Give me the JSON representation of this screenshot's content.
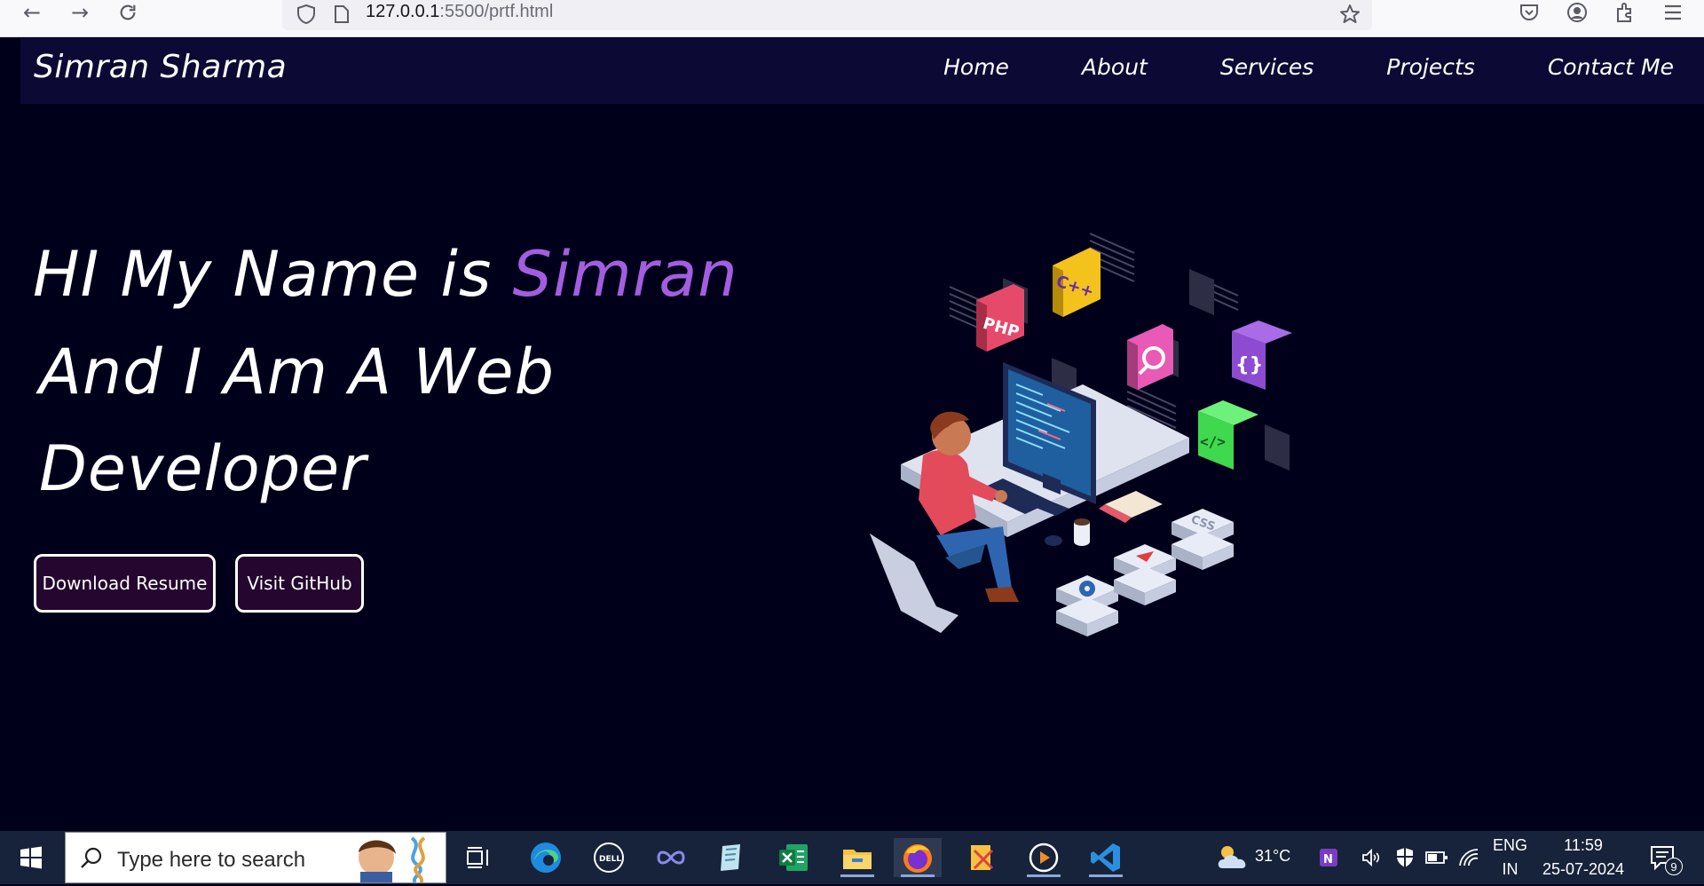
{
  "browser": {
    "url_host": "127.0.0.1",
    "url_path": ":5500/prtf.html"
  },
  "navbar": {
    "brand": "Simran Sharma",
    "links": [
      "Home",
      "About",
      "Services",
      "Projects",
      "Contact Me"
    ]
  },
  "hero": {
    "line1_prefix": "HI My Name is ",
    "line1_accent": "Simran",
    "line2": "And I Am A Web",
    "line3": "Developer",
    "accent_color": "#a35ee0",
    "buttons": {
      "download": "Download Resume",
      "github": "Visit GitHub"
    },
    "illustration_tiles": [
      "C++",
      "PHP",
      "{}",
      "</>",
      "CSS"
    ]
  },
  "taskbar": {
    "search_placeholder": "Type here to search",
    "weather": "31°C",
    "lang_top": "ENG",
    "lang_bottom": "IN",
    "time": "11:59",
    "date": "25-07-2024",
    "notifications": "9"
  }
}
